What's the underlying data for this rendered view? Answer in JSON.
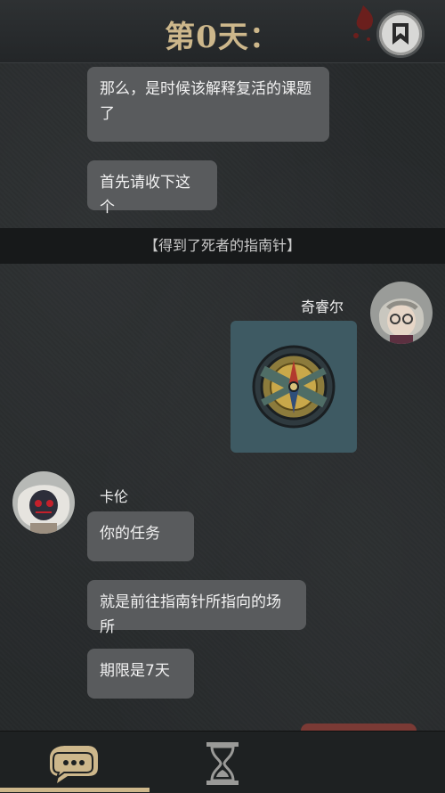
{
  "header": {
    "day_title": "第0天：",
    "bookmark_icon": "bookmark-icon"
  },
  "messages_top": [
    {
      "text_line1": "那么，是时候该解释复活的课题",
      "text_line2": "了"
    },
    {
      "text": "首先请收下这个"
    }
  ],
  "system_notice": "【得到了死者的指南针】",
  "player": {
    "name": "奇睿尔",
    "image": "compass-image"
  },
  "npc": {
    "name": "卡伦",
    "messages": [
      "你的任务",
      "就是前往指南针所指向的场所",
      "期限是7天"
    ]
  },
  "bottom_nav": {
    "tabs": [
      {
        "icon": "chat-bubble-icon",
        "active": true
      },
      {
        "icon": "hourglass-icon",
        "active": false
      }
    ]
  },
  "colors": {
    "accent": "#cdb78b",
    "bubble": "#595b5d",
    "background": "#26292b",
    "card": "#3e5a63"
  }
}
